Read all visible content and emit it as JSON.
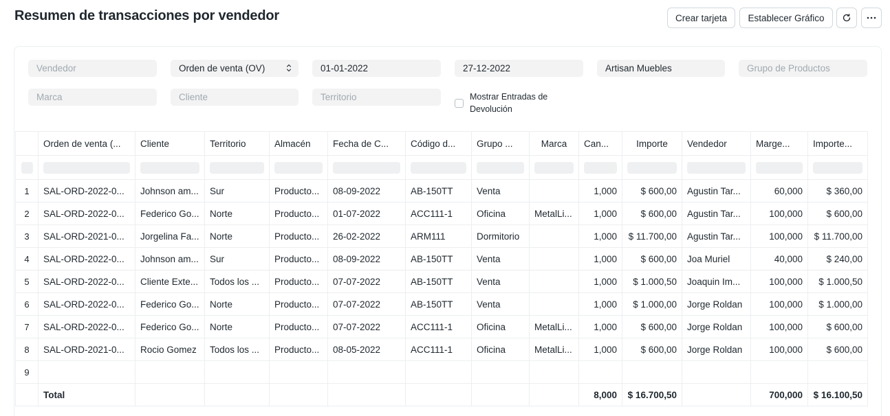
{
  "page": {
    "title": "Resumen de transacciones por vendedor"
  },
  "toolbar": {
    "create_card": "Crear tarjeta",
    "set_chart": "Establecer Gráfico",
    "refresh_icon": "refresh-icon",
    "more_icon": "more-horizontal-icon"
  },
  "filters": {
    "sales_person_placeholder": "Vendedor",
    "doc_type_value": "Orden de venta (OV)",
    "from_date": "01-01-2022",
    "to_date": "27-12-2022",
    "company": "Artisan Muebles",
    "item_group_placeholder": "Grupo de Productos",
    "brand_placeholder": "Marca",
    "customer_placeholder": "Cliente",
    "territory_placeholder": "Territorio",
    "show_return_label": "Mostrar Entradas de Devolución"
  },
  "table": {
    "columns": [
      "Orden de venta (...",
      "Cliente",
      "Territorio",
      "Almacén",
      "Fecha de C...",
      "Código d...",
      "Grupo ...",
      "Marca",
      "Can...",
      "Importe",
      "Vendedor",
      "Marge...",
      "Importe..."
    ],
    "rows": [
      [
        "1",
        "SAL-ORD-2022-0...",
        "Johnson am...",
        "Sur",
        "Producto...",
        "08-09-2022",
        "AB-150TT",
        "Venta",
        "",
        "1,000",
        "$ 600,00",
        "Agustin Tar...",
        "60,000",
        "$ 360,00"
      ],
      [
        "2",
        "SAL-ORD-2022-0...",
        "Federico Go...",
        "Norte",
        "Producto...",
        "01-07-2022",
        "ACC111-1",
        "Oficina",
        "MetalLi...",
        "1,000",
        "$ 600,00",
        "Agustin Tar...",
        "100,000",
        "$ 600,00"
      ],
      [
        "3",
        "SAL-ORD-2021-0...",
        "Jorgelina Fa...",
        "Norte",
        "Producto...",
        "26-02-2022",
        "ARM111",
        "Dormitorio",
        "",
        "1,000",
        "$ 11.700,00",
        "Agustin Tar...",
        "100,000",
        "$ 11.700,00"
      ],
      [
        "4",
        "SAL-ORD-2022-0...",
        "Johnson am...",
        "Sur",
        "Producto...",
        "08-09-2022",
        "AB-150TT",
        "Venta",
        "",
        "1,000",
        "$ 600,00",
        "Joa Muriel",
        "40,000",
        "$ 240,00"
      ],
      [
        "5",
        "SAL-ORD-2022-0...",
        "Cliente Exte...",
        "Todos los ...",
        "Producto...",
        "07-07-2022",
        "AB-150TT",
        "Venta",
        "",
        "1,000",
        "$ 1.000,50",
        "Joaquin Im...",
        "100,000",
        "$ 1.000,50"
      ],
      [
        "6",
        "SAL-ORD-2022-0...",
        "Federico Go...",
        "Norte",
        "Producto...",
        "07-07-2022",
        "AB-150TT",
        "Venta",
        "",
        "1,000",
        "$ 1.000,00",
        "Jorge Roldan",
        "100,000",
        "$ 1.000,00"
      ],
      [
        "7",
        "SAL-ORD-2022-0...",
        "Federico Go...",
        "Norte",
        "Producto...",
        "07-07-2022",
        "ACC111-1",
        "Oficina",
        "MetalLi...",
        "1,000",
        "$ 600,00",
        "Jorge Roldan",
        "100,000",
        "$ 600,00"
      ],
      [
        "8",
        "SAL-ORD-2021-0...",
        "Rocio Gomez",
        "Todos los ...",
        "Producto...",
        "08-05-2022",
        "ACC111-1",
        "Oficina",
        "MetalLi...",
        "1,000",
        "$ 600,00",
        "Jorge Roldan",
        "100,000",
        "$ 600,00"
      ],
      [
        "9",
        "",
        "",
        "",
        "",
        "",
        "",
        "",
        "",
        "",
        "",
        "",
        "",
        ""
      ]
    ],
    "total": [
      "",
      "Total",
      "",
      "",
      "",
      "",
      "",
      "",
      "",
      "8,000",
      "$ 16.700,50",
      "",
      "700,000",
      "$ 16.100,50"
    ]
  }
}
